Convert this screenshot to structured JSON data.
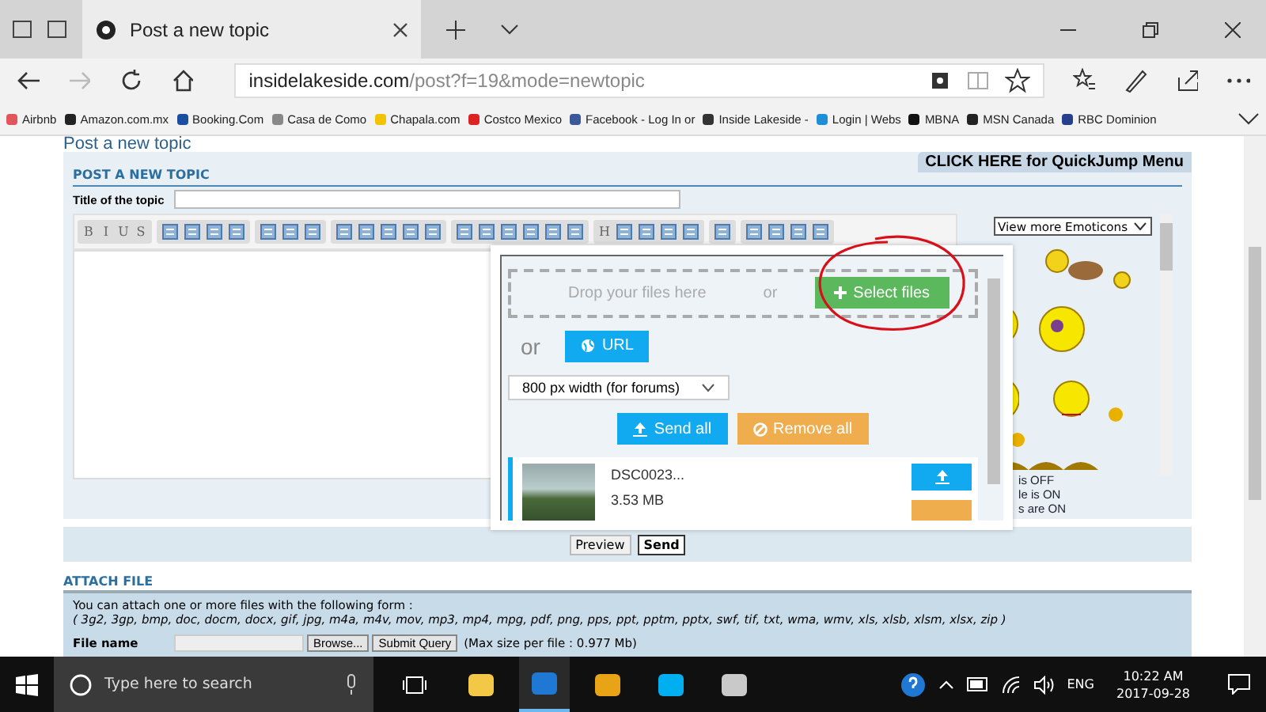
{
  "browser": {
    "tabs": [
      {
        "title": "Post a new topic",
        "selected": true
      }
    ],
    "address": {
      "domain": "insidelakeside.com",
      "path": "/post?f=19&mode=newtopic"
    },
    "bookmarks": [
      "Airbnb",
      "Amazon.com.mx",
      "Booking.Com",
      "Casa de Como",
      "Chapala.com",
      "Costco Mexico",
      "Facebook - Log In or",
      "Inside Lakeside -",
      "Login | Webs",
      "MBNA",
      "MSN Canada",
      "RBC Dominion"
    ]
  },
  "page": {
    "heading": "Post a new topic",
    "quickjump": "CLICK HERE for QuickJump Menu",
    "section_title": "POST A NEW TOPIC",
    "title_label": "Title of the topic",
    "toolbar_groups": [
      [
        {
          "kind": "letter",
          "label": "B"
        },
        {
          "kind": "letter",
          "label": "I"
        },
        {
          "kind": "letter",
          "label": "U"
        },
        {
          "kind": "letter",
          "label": "S"
        }
      ],
      [
        {
          "kind": "icon"
        },
        {
          "kind": "icon"
        },
        {
          "kind": "icon"
        },
        {
          "kind": "icon"
        }
      ],
      [
        {
          "kind": "icon"
        },
        {
          "kind": "icon"
        },
        {
          "kind": "icon"
        }
      ],
      [
        {
          "kind": "icon"
        },
        {
          "kind": "icon"
        },
        {
          "kind": "icon"
        },
        {
          "kind": "icon"
        },
        {
          "kind": "icon"
        }
      ],
      [
        {
          "kind": "icon"
        },
        {
          "kind": "icon"
        },
        {
          "kind": "icon"
        },
        {
          "kind": "icon"
        },
        {
          "kind": "icon"
        },
        {
          "kind": "icon"
        }
      ],
      [
        {
          "kind": "letter",
          "label": "H"
        },
        {
          "kind": "icon"
        },
        {
          "kind": "icon"
        },
        {
          "kind": "icon"
        },
        {
          "kind": "icon"
        }
      ],
      [
        {
          "kind": "icon"
        }
      ],
      [
        {
          "kind": "icon"
        },
        {
          "kind": "icon"
        },
        {
          "kind": "icon"
        },
        {
          "kind": "icon"
        }
      ]
    ],
    "emoticons_dropdown": "View more Emoticons",
    "status_lines": [
      "is OFF",
      "le is ON",
      "s are ON"
    ],
    "upload": {
      "drop_text": "Drop your files here",
      "or_1": "or",
      "select_button": "Select files",
      "or_2": "or",
      "url_button": "URL",
      "size_select": "800 px width (for forums)",
      "send_all": "Send all",
      "remove_all": "Remove all",
      "file": {
        "name": "DSC0023...",
        "size": "3.53 MB"
      }
    },
    "buttons": [
      {
        "label": "Preview",
        "primary": false
      },
      {
        "label": "Send",
        "primary": true
      }
    ],
    "attach": {
      "title": "ATTACH FILE",
      "intro": "You can attach one or more files with the following form :",
      "types": "( 3g2, 3gp, bmp, doc, docm, docx, gif, jpg, m4a, m4v, mov, mp3, mp4, mpg, pdf, png, pps, ppt, pptm, pptx, swf, tif, txt, wma, wmv, xls, xlsb, xlsm, xlsx, zip )",
      "file_label": "File name",
      "browse": "Browse...",
      "submit": "Submit Query",
      "max_size": "(Max size per file : 0.977 Mb)"
    }
  },
  "taskbar": {
    "search_placeholder": "Type here to search",
    "apps": [
      {
        "kind": "folder",
        "selected": false
      },
      {
        "kind": "edge",
        "selected": true
      },
      {
        "kind": "outlook",
        "selected": false
      },
      {
        "kind": "skype",
        "selected": false
      },
      {
        "kind": "paint",
        "selected": false
      }
    ],
    "language": "ENG",
    "time": "10:22 AM",
    "date": "2017-09-28"
  }
}
